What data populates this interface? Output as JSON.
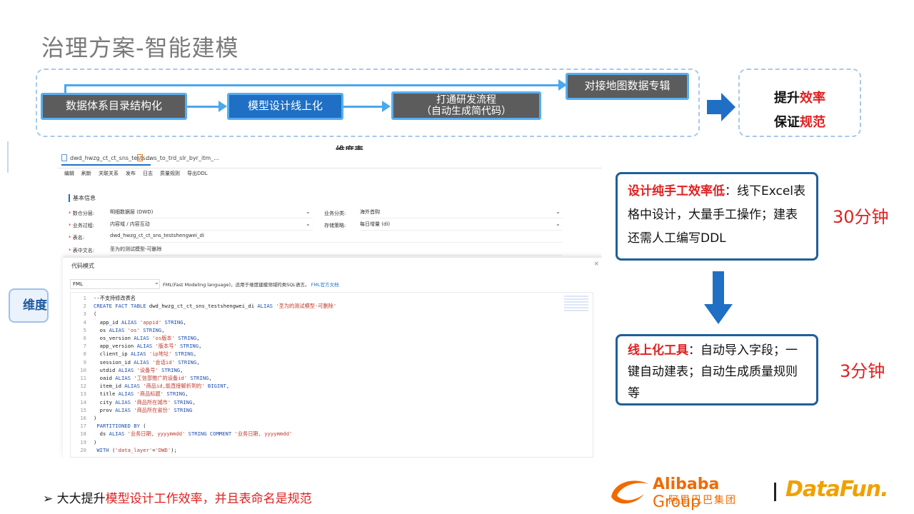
{
  "slide": {
    "title": "治理方案-智能建模"
  },
  "flow": {
    "node1": "数据体系目录结构化",
    "node2": "模型设计线上化",
    "node3_line1": "打通研发流程",
    "node3_line2": "（自动生成简代码）",
    "node4": "对接地图数据专辑"
  },
  "result": {
    "line1_prefix": "提升",
    "line1_highlight": "效率",
    "line2_prefix": "保证",
    "line2_highlight": "规范"
  },
  "screenshot": {
    "heading": "维度表",
    "tabs": [
      "dwd_hwzg_ct_ct_sns_tests...",
      "dws_to_trd_slr_byr_itm_..."
    ],
    "toolbar": [
      "编辑",
      "刷新",
      "关联关系",
      "发布",
      "日志",
      "质量规则",
      "导出DDL"
    ],
    "info_title": "基本信息",
    "fields": {
      "layer_label": "数仓分层:",
      "layer_value": "明细数据层 (DWD)",
      "domain_label": "业务过程:",
      "domain_value": "内容域 / 内容互动",
      "table_label": "表名:",
      "table_value": "dwd_hwzg_ct_ct_sns_testshengwei_di",
      "cn_label": "表中文名:",
      "cn_value": "圣为的测试模型-可删除",
      "biz_label": "业务分类:",
      "biz_value": "海外首购",
      "store_label": "存储策略:",
      "store_value": "每日增量 (di)"
    },
    "modal": {
      "title": "代码模式",
      "close": "×",
      "select_value": "FML",
      "desc": "FML(Fast Modeling language)，适用于维度建模领域的类SQL语言。",
      "doc_link": "FML官方文档"
    },
    "code_lines": [
      {
        "n": "1",
        "t": "--不支持修改表名"
      },
      {
        "n": "2",
        "t": "CREATE FACT TABLE dwd_hwzg_ct_ct_sns_testshengwei_di ALIAS '圣为的测试模型-可删除'"
      },
      {
        "n": "3",
        "t": "("
      },
      {
        "n": "4",
        "t": "  app_id ALIAS 'appid' STRING,"
      },
      {
        "n": "5",
        "t": "  os ALIAS 'os' STRING,"
      },
      {
        "n": "6",
        "t": "  os_version ALIAS 'os版本' STRING,"
      },
      {
        "n": "7",
        "t": "  app_version ALIAS '版本号' STRING,"
      },
      {
        "n": "8",
        "t": "  client_ip ALIAS 'ip地址' STRING,"
      },
      {
        "n": "9",
        "t": "  session_id ALIAS '会话id' STRING,"
      },
      {
        "n": "10",
        "t": "  utdid ALIAS '设备号' STRING,"
      },
      {
        "n": "11",
        "t": "  oaid ALIAS '工信部推广的设备id' STRING,"
      },
      {
        "n": "12",
        "t": "  item_id ALIAS '商品id,能直接解析到的' BIGINT,"
      },
      {
        "n": "13",
        "t": "  title ALIAS '商品标题' STRING,"
      },
      {
        "n": "14",
        "t": "  city ALIAS '商品所在城市' STRING,"
      },
      {
        "n": "15",
        "t": "  prov ALIAS '商品所在省份' STRING"
      },
      {
        "n": "16",
        "t": ")"
      },
      {
        "n": "17",
        "t": " PARTITIONED BY ("
      },
      {
        "n": "18",
        "t": "  ds ALIAS '业务日期, yyyymmdd' STRING COMMENT '业务日期, yyyymmdd'"
      },
      {
        "n": "19",
        "t": ")"
      },
      {
        "n": "20",
        "t": " WITH ('data_layer'='DWD');"
      }
    ],
    "sidebar_fragment": "维度"
  },
  "notes": {
    "note1_highlight": "设计纯手工效率低",
    "note1_text": "：线下Excel表格中设计，大量手工操作；建表还需人工编写DDL",
    "note1_time": "30分钟",
    "note2_highlight": "线上化工具",
    "note2_text": "：自动导入字段；一键自动建表；自动生成质量规则等",
    "note2_time": "3分钟"
  },
  "footer": {
    "bullet": "➢",
    "prefix": "大大提升",
    "highlight": "模型设计工作效率，并且表命名是规范"
  },
  "logos": {
    "alibaba_en_bold": "Alibaba",
    "alibaba_en_light": " Group",
    "alibaba_cn": "阿里巴巴集团",
    "datafun": "DataFun."
  },
  "colors": {
    "accent_blue": "#1f6fc4",
    "line_blue": "#4aa8ee",
    "highlight_red": "#e02020",
    "alibaba_orange": "#f06a00"
  }
}
